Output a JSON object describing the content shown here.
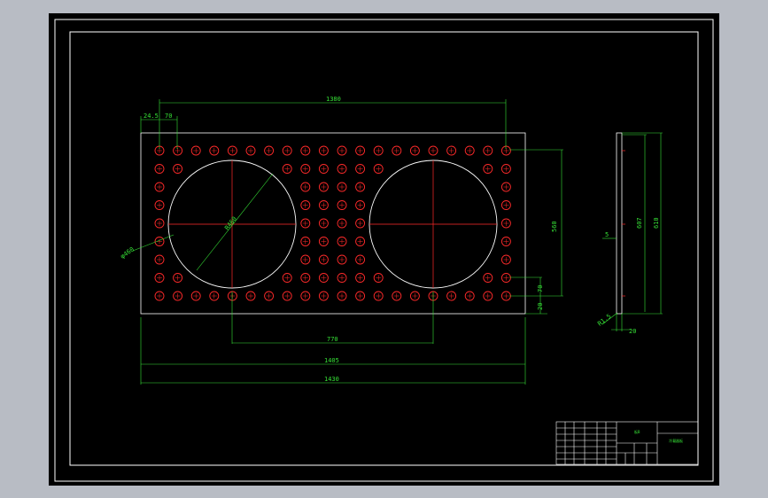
{
  "colors": {
    "background": "#b8bcc4",
    "sheet": "#000000",
    "border": "#ffffff",
    "dimension": "#36e236",
    "hole_fill": "#ff2a2a",
    "centerline": "#ff2a2a",
    "outline": "#ffffff"
  },
  "plate": {
    "hole_columns": 20,
    "hole_rows": 9,
    "large_circles": 2,
    "large_circle_count_columns_covered": 8
  },
  "dimensions": {
    "top_total_pitch": "1380",
    "first_offset": "24.5",
    "pitch": "70",
    "diameter_label": "φ460",
    "radius_label": "R460",
    "vertical_pitch_total": "560",
    "vertical_pitch": "70",
    "vertical_edge": "20",
    "circle_center_distance": "770",
    "inner_length": "1405",
    "outer_length": "1430",
    "side_height_inner": "607",
    "side_height_outer": "610",
    "side_thickness": "5",
    "side_chamfer": "R1.5",
    "side_base": "20"
  },
  "title_block": {
    "title_left": "板B",
    "title_right": "冷凝器板"
  }
}
